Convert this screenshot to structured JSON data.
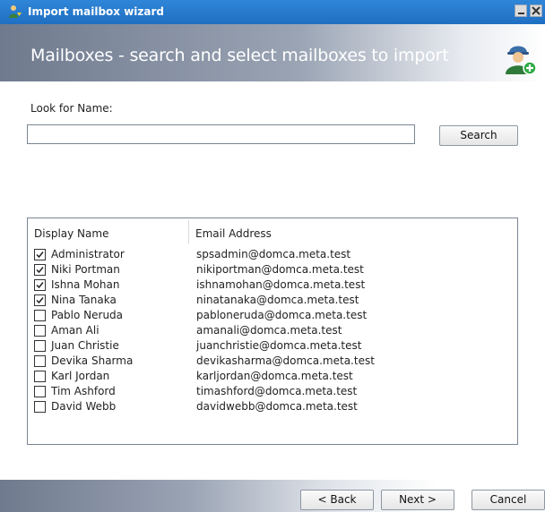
{
  "window": {
    "title": "Import mailbox wizard"
  },
  "header": {
    "subtitle": "Mailboxes - search and select mailboxes to import"
  },
  "search": {
    "label": "Look for Name:",
    "value": "",
    "button_label": "Search"
  },
  "list": {
    "columns": [
      "Display Name",
      "Email Address"
    ],
    "rows": [
      {
        "checked": true,
        "name": "Administrator",
        "email": "spsadmin@domca.meta.test"
      },
      {
        "checked": true,
        "name": "Niki Portman",
        "email": "nikiportman@domca.meta.test"
      },
      {
        "checked": true,
        "name": "Ishna Mohan",
        "email": "ishnamohan@domca.meta.test"
      },
      {
        "checked": true,
        "name": "Nina Tanaka",
        "email": "ninatanaka@domca.meta.test"
      },
      {
        "checked": false,
        "name": "Pablo Neruda",
        "email": "pabloneruda@domca.meta.test"
      },
      {
        "checked": false,
        "name": "Aman Ali",
        "email": "amanali@domca.meta.test"
      },
      {
        "checked": false,
        "name": "Juan Christie",
        "email": "juanchristie@domca.meta.test"
      },
      {
        "checked": false,
        "name": "Devika Sharma",
        "email": "devikasharma@domca.meta.test"
      },
      {
        "checked": false,
        "name": "Karl Jordan",
        "email": "karljordan@domca.meta.test"
      },
      {
        "checked": false,
        "name": "Tim Ashford",
        "email": "timashford@domca.meta.test"
      },
      {
        "checked": false,
        "name": "David Webb",
        "email": "davidwebb@domca.meta.test"
      }
    ]
  },
  "footer": {
    "back_label": "< Back",
    "next_label": "Next >",
    "cancel_label": "Cancel"
  },
  "icons": {
    "app": "user-import-icon",
    "header": "user-add-icon",
    "minimize": "minimize-icon",
    "close": "close-icon"
  },
  "colors": {
    "titlebar": "#1f6fc2",
    "header_dark": "#6f7a8e"
  }
}
